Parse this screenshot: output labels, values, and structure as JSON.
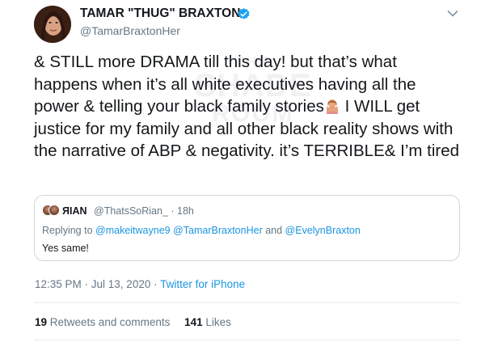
{
  "author": {
    "display_name": "TAMAR \"THUG\" BRAXTON",
    "handle": "@TamarBraxtonHer",
    "avatar": "profile-photo",
    "verified_icon": "verified-badge-icon"
  },
  "tweet": {
    "text_before_emoji": "& STILL more DRAMA till this day! but that’s what happens when it’s all white executives having all the power & telling your black family stories",
    "emoji": "woman-gesturing-no",
    "text_after_emoji": " I WILL get justice for my family and all other black reality shows with the narrative of ABP & negativity. it’s TERRIBLE& I’m tired"
  },
  "quote": {
    "name": "ЯIAN",
    "handle_time": "@ThatsSoRian_ · 18h",
    "reply_prefix": "Replying to ",
    "mention_1": "@makeitwayne9",
    "mention_2": "@TamarBraxtonHer",
    "and_text": " and ",
    "mention_3": "@EvelynBraxton",
    "text": "Yes same!"
  },
  "meta": {
    "timestamp": "12:35 PM · Jul 13, 2020 · ",
    "source": "Twitter for iPhone"
  },
  "stats": {
    "retweets_count": "19",
    "retweets_label": " Retweets and comments",
    "likes_count": "141",
    "likes_label": " Likes"
  },
  "watermark": {
    "line1": "THE",
    "line2": "SHADE",
    "line3": "ROOM"
  },
  "colors": {
    "link": "#1b95e0",
    "verified": "#1da1f2",
    "secondary_text": "#657786",
    "primary_text": "#14171a",
    "border": "#ccd6dd"
  }
}
